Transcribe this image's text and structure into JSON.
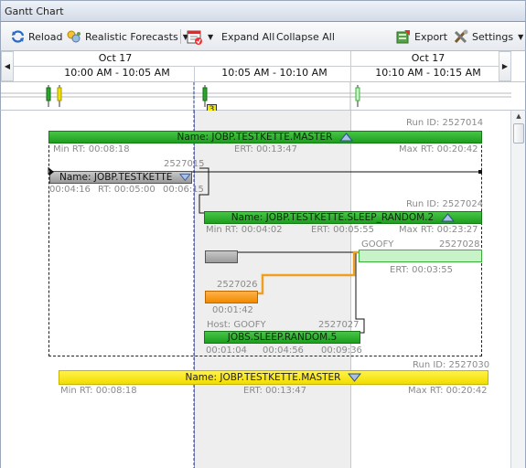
{
  "window": {
    "title": "Gantt Chart"
  },
  "toolbar": {
    "reload": "Reload",
    "forecasts": "Realistic Forecasts",
    "expand_all": "Expand All",
    "collapse_all": "Collapse All",
    "export": "Export",
    "settings": "Settings"
  },
  "timeline": {
    "dates": [
      "Oct 17",
      "Oct 17"
    ],
    "ranges": [
      "10:00 AM - 10:05 AM",
      "10:05 AM - 10:10 AM",
      "10:10 AM - 10:15 AM"
    ],
    "overview_count": "3"
  },
  "jobs": {
    "master1": {
      "run_id": "Run ID: 2527014",
      "name": "Name: JOBP.TESTKETTE.MASTER",
      "min_rt": "Min RT: 00:08:18",
      "ert": "ERT: 00:13:47",
      "max_rt": "Max RT: 00:20:42"
    },
    "testkette": {
      "id": "2527015",
      "name": "Name: JOBP.TESTKETTE",
      "start": "00:04:16",
      "rt": "RT: 00:05:00",
      "end": "00:06:15"
    },
    "sleep_random": {
      "run_id": "Run ID: 2527024",
      "name": "Name: JOBP.TESTKETTE.SLEEP_RANDOM.2",
      "min_rt": "Min RT: 00:04:02",
      "ert": "ERT: 00:05:55",
      "max_rt": "Max RT: 00:23:27"
    },
    "goofy": {
      "host": "GOOFY",
      "id": "2527028",
      "ert": "ERT: 00:03:55"
    },
    "orange": {
      "id": "2527026",
      "time": "00:01:42"
    },
    "sleep5": {
      "host": "Host: GOOFY",
      "id": "2527027",
      "name": "JOBS.SLEEP.RANDOM.5",
      "start": "00:01:04",
      "mid": "00:04:56",
      "end": "00:09:36"
    },
    "master2": {
      "run_id": "Run ID: 2527030",
      "name": "Name: JOBP.TESTKETTE.MASTER",
      "min_rt": "Min RT: 00:08:18",
      "ert": "ERT: 00:13:47",
      "max_rt": "Max RT: 00:20:42"
    }
  }
}
